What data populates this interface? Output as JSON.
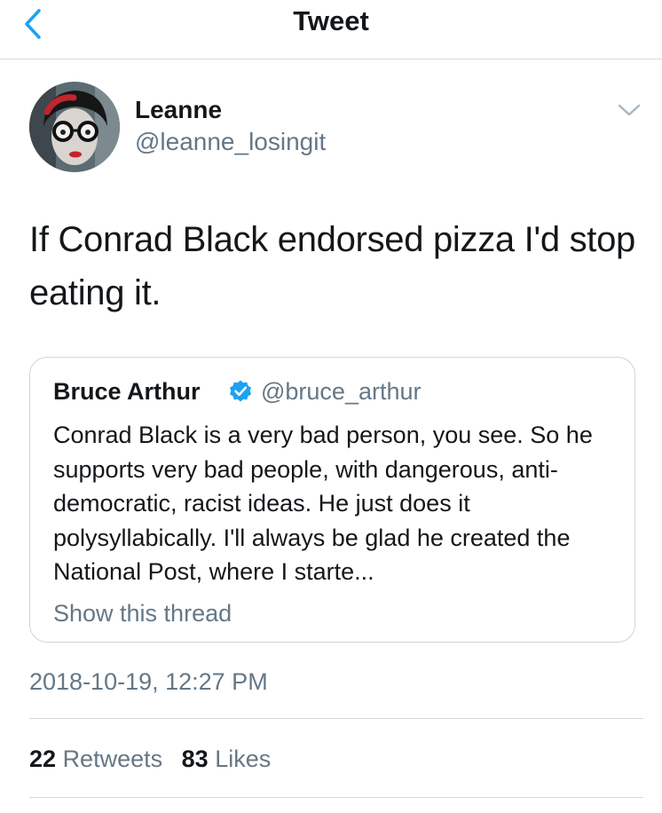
{
  "header": {
    "title": "Tweet",
    "back_icon": "chevron-left-icon"
  },
  "tweet": {
    "author": {
      "name": "Leanne",
      "handle": "@leanne_losingit"
    },
    "text": "If Conrad Black endorsed pizza I'd stop eating it.",
    "menu_icon": "chevron-down-icon"
  },
  "quote": {
    "author": {
      "name": "Bruce Arthur",
      "handle": "@bruce_arthur",
      "verified_icon": "verified-badge-icon"
    },
    "text": "Conrad Black is a very bad person, you see. So he supports very bad people, with dangerous, anti-democratic, racist ideas. He just does it polysyllabically. I'll always be glad he created the National Post, where I starte...",
    "show_thread": "Show this thread"
  },
  "meta": {
    "timestamp": "2018-10-19, 12:27 PM"
  },
  "stats": {
    "retweets_count": "22",
    "retweets_label": "Retweets",
    "likes_count": "83",
    "likes_label": "Likes"
  },
  "colors": {
    "accent": "#1da1f2",
    "secondary_text": "#657786",
    "divider": "#d8d8dc"
  }
}
